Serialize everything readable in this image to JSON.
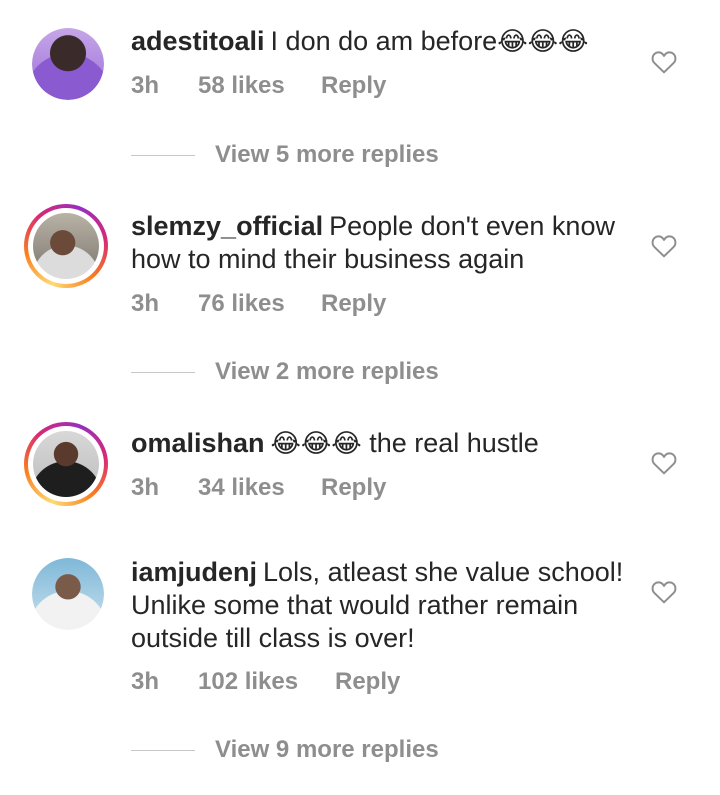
{
  "comments": [
    {
      "username": "adestitoali",
      "text": "I don do am before",
      "emoji_suffix": "😂😂😂",
      "time": "3h",
      "likes": "58 likes",
      "reply": "Reply",
      "view_more": "View 5 more replies",
      "avatar_icon": "user-avatar-photo"
    },
    {
      "username": "slemzy_official",
      "text": "People don't even know how to mind their business again",
      "time": "3h",
      "likes": "76 likes",
      "reply": "Reply",
      "view_more": "View 2 more replies",
      "avatar_icon": "user-avatar-photo"
    },
    {
      "username": "omalishan",
      "emoji_prefix": "😂😂😂",
      "text": "the real hustle",
      "time": "3h",
      "likes": "34 likes",
      "reply": "Reply",
      "avatar_icon": "user-avatar-photo"
    },
    {
      "username": "iamjudenj",
      "text": "Lols, atleast she value school! Unlike some that would rather remain outside till class is over!",
      "time": "3h",
      "likes": "102 likes",
      "reply": "Reply",
      "view_more": "View 9 more replies",
      "avatar_icon": "user-avatar-photo"
    }
  ],
  "colors": {
    "text": "#262626",
    "meta": "#8e8e8e",
    "divider": "#c7c7c7",
    "story_ring": [
      "#feda75",
      "#fa7e1e",
      "#d62976",
      "#962fbf"
    ]
  },
  "icons": {
    "like": "heart-outline-icon"
  }
}
